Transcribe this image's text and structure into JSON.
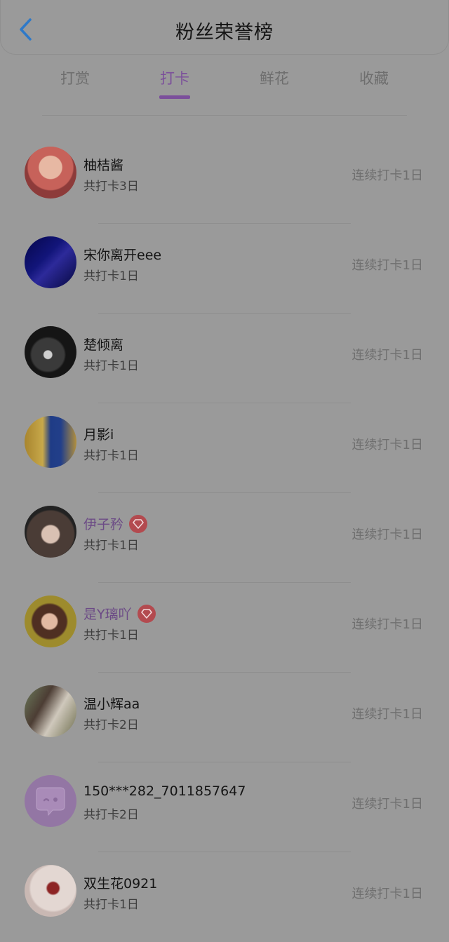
{
  "header": {
    "title": "粉丝荣誉榜"
  },
  "tabs": [
    {
      "label": "打赏",
      "active": false
    },
    {
      "label": "打卡",
      "active": true
    },
    {
      "label": "鲜花",
      "active": false
    },
    {
      "label": "收藏",
      "active": false
    }
  ],
  "fans": [
    {
      "name": "柚桔酱",
      "total": "共打卡3日",
      "streak": "连续打卡1日",
      "vip": false
    },
    {
      "name": "宋你离开eee",
      "total": "共打卡1日",
      "streak": "连续打卡1日",
      "vip": false
    },
    {
      "name": "楚倾离",
      "total": "共打卡1日",
      "streak": "连续打卡1日",
      "vip": false
    },
    {
      "name": "月影i",
      "total": "共打卡1日",
      "streak": "连续打卡1日",
      "vip": false
    },
    {
      "name": "伊子矜",
      "total": "共打卡1日",
      "streak": "连续打卡1日",
      "vip": true
    },
    {
      "name": "是Y璃吖",
      "total": "共打卡1日",
      "streak": "连续打卡1日",
      "vip": true
    },
    {
      "name": "温小辉aa",
      "total": "共打卡2日",
      "streak": "连续打卡1日",
      "vip": false
    },
    {
      "name": "150***282_7011857647",
      "total": "共打卡2日",
      "streak": "连续打卡1日",
      "vip": false
    },
    {
      "name": "双生花0921",
      "total": "共打卡1日",
      "streak": "连续打卡1日",
      "vip": false
    }
  ],
  "colors": {
    "accent": "#7b4f9b",
    "back_icon": "#2e79c8",
    "vip_badge": "#b34a4f"
  }
}
